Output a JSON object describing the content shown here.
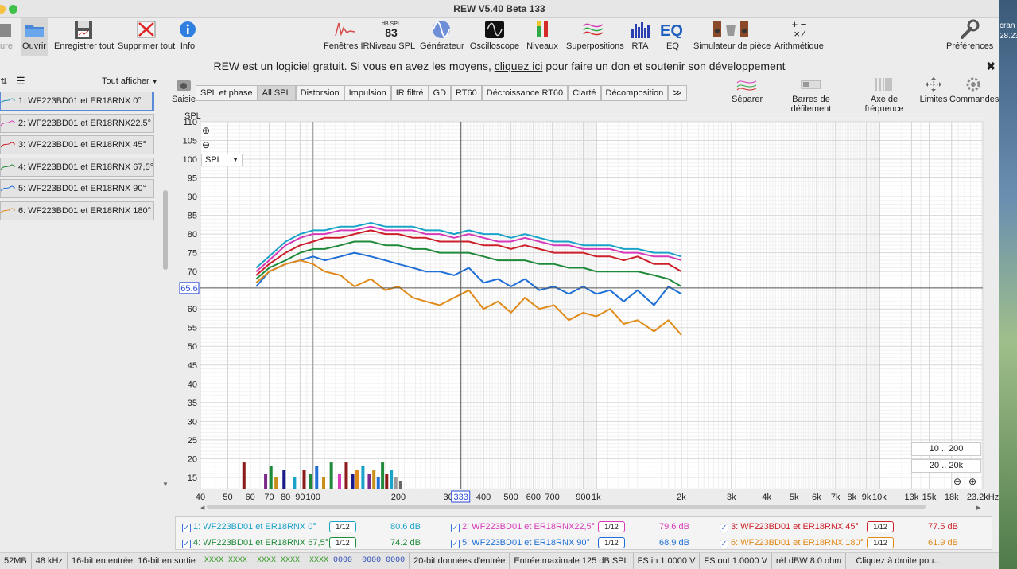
{
  "window": {
    "title": "REW V5.40 Beta 133"
  },
  "toolbar": {
    "left": [
      {
        "label": "ure"
      },
      {
        "label": "Ouvrir"
      },
      {
        "label": "Enregistrer tout"
      },
      {
        "label": "Supprimer tout"
      },
      {
        "label": "Info"
      }
    ],
    "center": [
      {
        "label": "Fenêtres IR"
      },
      {
        "label": "Niveau SPL",
        "badge_top": "dB SPL",
        "badge_val": "83"
      },
      {
        "label": "Générateur"
      },
      {
        "label": "Oscilloscope"
      },
      {
        "label": "Niveaux"
      },
      {
        "label": "Superpositions"
      },
      {
        "label": "RTA"
      },
      {
        "label": "EQ"
      },
      {
        "label": "Simulateur de pièce"
      },
      {
        "label": "Arithmétique"
      }
    ],
    "right": {
      "label": "Préférences"
    }
  },
  "banner": {
    "before": "REW est un logiciel gratuit. Si vous en avez les moyens, ",
    "link": "cliquez ici",
    "after": " pour faire un don et soutenir son développement"
  },
  "left_panel": {
    "show_all": "Tout afficher",
    "capture": "Saisie",
    "items": [
      {
        "label": "1: WF223BD01 et ER18RNX 0°",
        "color": "#1a8fb8"
      },
      {
        "label": "2: WF223BD01 et ER18RNX22,5°",
        "color": "#d63ab8"
      },
      {
        "label": "3: WF223BD01 et ER18RNX 45°",
        "color": "#cc1f2a"
      },
      {
        "label": "4: WF223BD01 et ER18RNX 67,5°",
        "color": "#1f8a3a"
      },
      {
        "label": "5: WF223BD01 et ER18RNX 90°",
        "color": "#1f6fd6"
      },
      {
        "label": "6: WF223BD01 et ER18RNX 180°",
        "color": "#e08a1a"
      }
    ]
  },
  "tabs": [
    "SPL et phase",
    "All SPL",
    "Distorsion",
    "Impulsion",
    "IR filtré",
    "GD",
    "RT60",
    "Décroissance RT60",
    "Clarté",
    "Décomposition",
    "≫"
  ],
  "right_tools": [
    "Séparer",
    "Barres de défilement",
    "Axe de fréquence",
    "Limites",
    "Commandes"
  ],
  "plot": {
    "y_axis_label": "SPL",
    "dropdown": "SPL",
    "cursor_value": "65.6",
    "cursor_freq": "333",
    "range_buttons": [
      "10 .. 200",
      "20 .. 20k"
    ]
  },
  "chart_data": {
    "type": "line",
    "ylabel": "SPL",
    "xlabel": "",
    "xscale": "log",
    "xlim": [
      40,
      23200
    ],
    "ylim": [
      10,
      110
    ],
    "y_ticks": [
      15,
      20,
      25,
      30,
      35,
      40,
      45,
      50,
      55,
      60,
      65,
      70,
      75,
      80,
      85,
      90,
      95,
      100,
      105,
      110
    ],
    "x_tick_labels": [
      {
        "f": 40,
        "t": "40"
      },
      {
        "f": 50,
        "t": "50"
      },
      {
        "f": 60,
        "t": "60"
      },
      {
        "f": 70,
        "t": "70"
      },
      {
        "f": 80,
        "t": "80"
      },
      {
        "f": 90,
        "t": "90"
      },
      {
        "f": 100,
        "t": "100"
      },
      {
        "f": 200,
        "t": "200"
      },
      {
        "f": 300,
        "t": "30"
      },
      {
        "f": 400,
        "t": "400"
      },
      {
        "f": 500,
        "t": "500"
      },
      {
        "f": 600,
        "t": "600"
      },
      {
        "f": 700,
        "t": "700"
      },
      {
        "f": 900,
        "t": "900"
      },
      {
        "f": 1000,
        "t": "1k"
      },
      {
        "f": 2000,
        "t": "2k"
      },
      {
        "f": 3000,
        "t": "3k"
      },
      {
        "f": 4000,
        "t": "4k"
      },
      {
        "f": 5000,
        "t": "5k"
      },
      {
        "f": 6000,
        "t": "6k"
      },
      {
        "f": 7000,
        "t": "7k"
      },
      {
        "f": 8000,
        "t": "8k"
      },
      {
        "f": 9000,
        "t": "9k"
      },
      {
        "f": 10000,
        "t": "10k"
      },
      {
        "f": 13000,
        "t": "13k"
      },
      {
        "f": 15000,
        "t": "15k"
      },
      {
        "f": 18000,
        "t": "18k"
      },
      {
        "f": 23200,
        "t": "23.2kHz"
      }
    ],
    "x": [
      63,
      70,
      80,
      90,
      100,
      110,
      125,
      140,
      160,
      180,
      200,
      225,
      250,
      280,
      315,
      355,
      400,
      450,
      500,
      560,
      630,
      710,
      800,
      900,
      1000,
      1120,
      1250,
      1400,
      1600,
      1800,
      2000
    ],
    "series": [
      {
        "name": "1: WF223BD01 et ER18RNX 0°",
        "color": "#1aa3c8",
        "values": [
          71,
          74,
          78,
          80,
          81,
          81,
          82,
          82,
          83,
          82,
          82,
          82,
          81,
          81,
          80,
          81,
          80,
          80,
          79,
          80,
          79,
          78,
          78,
          77,
          77,
          77,
          76,
          76,
          75,
          75,
          74
        ]
      },
      {
        "name": "2: WF223BD01 et ER18RNX22,5°",
        "color": "#d63ab8",
        "values": [
          70,
          73,
          77,
          79,
          80,
          80,
          81,
          81,
          82,
          81,
          81,
          81,
          80,
          80,
          79,
          80,
          79,
          78,
          78,
          79,
          78,
          77,
          77,
          76,
          76,
          76,
          75,
          75,
          74,
          74,
          73
        ]
      },
      {
        "name": "3: WF223BD01 et ER18RNX 45°",
        "color": "#cc1f2a",
        "values": [
          69,
          72,
          75,
          77,
          78,
          79,
          79,
          80,
          81,
          80,
          80,
          79,
          79,
          78,
          78,
          78,
          77,
          77,
          76,
          77,
          76,
          75,
          75,
          75,
          74,
          74,
          73,
          74,
          72,
          72,
          70
        ]
      },
      {
        "name": "4: WF223BD01 et ER18RNX 67,5°",
        "color": "#1f8a3a",
        "values": [
          68,
          71,
          73,
          75,
          76,
          76,
          77,
          78,
          78,
          77,
          77,
          76,
          76,
          75,
          75,
          75,
          74,
          73,
          73,
          73,
          72,
          72,
          71,
          71,
          70,
          70,
          70,
          70,
          69,
          68,
          66
        ]
      },
      {
        "name": "5: WF223BD01 et ER18RNX 90°",
        "color": "#1f6fd6",
        "values": [
          66,
          70,
          72,
          73,
          74,
          73,
          74,
          75,
          74,
          73,
          72,
          71,
          70,
          70,
          69,
          71,
          67,
          68,
          66,
          68,
          65,
          66,
          64,
          66,
          64,
          65,
          62,
          65,
          61,
          66,
          64
        ]
      },
      {
        "name": "6: WF223BD01 et ER18RNX 180°",
        "color": "#e08a1a",
        "values": [
          67,
          70,
          72,
          73,
          72,
          70,
          69,
          66,
          68,
          65,
          66,
          63,
          62,
          61,
          63,
          65,
          60,
          62,
          59,
          63,
          60,
          61,
          57,
          59,
          58,
          60,
          56,
          57,
          54,
          57,
          53
        ]
      }
    ],
    "bars": [
      {
        "f": 57,
        "h": 19,
        "c": "#8b1a1a"
      },
      {
        "f": 68,
        "h": 16,
        "c": "#7a2a8a"
      },
      {
        "f": 71,
        "h": 18,
        "c": "#1f8a3a"
      },
      {
        "f": 74,
        "h": 15,
        "c": "#c8901a"
      },
      {
        "f": 79,
        "h": 17,
        "c": "#1a1a8a"
      },
      {
        "f": 86,
        "h": 15,
        "c": "#1aa3c8"
      },
      {
        "f": 93,
        "h": 17,
        "c": "#8b1a1a"
      },
      {
        "f": 98,
        "h": 16,
        "c": "#1f8a3a"
      },
      {
        "f": 103,
        "h": 18,
        "c": "#1f6fd6"
      },
      {
        "f": 109,
        "h": 15,
        "c": "#c8901a"
      },
      {
        "f": 116,
        "h": 19,
        "c": "#1f8a3a"
      },
      {
        "f": 124,
        "h": 16,
        "c": "#d63ab8"
      },
      {
        "f": 131,
        "h": 19,
        "c": "#8b1a1a"
      },
      {
        "f": 138,
        "h": 16,
        "c": "#1a1a8a"
      },
      {
        "f": 143,
        "h": 17,
        "c": "#e08a1a"
      },
      {
        "f": 150,
        "h": 18,
        "c": "#1aa3c8"
      },
      {
        "f": 158,
        "h": 16,
        "c": "#7a2a8a"
      },
      {
        "f": 164,
        "h": 17,
        "c": "#c8901a"
      },
      {
        "f": 170,
        "h": 15,
        "c": "#1f6fd6"
      },
      {
        "f": 176,
        "h": 19,
        "c": "#1f8a3a"
      },
      {
        "f": 182,
        "h": 16,
        "c": "#8b1a1a"
      },
      {
        "f": 189,
        "h": 17,
        "c": "#1aa3c8"
      },
      {
        "f": 196,
        "h": 15,
        "c": "#9a9a9a"
      },
      {
        "f": 204,
        "h": 14,
        "c": "#666666"
      }
    ]
  },
  "legend": [
    {
      "label": "1: WF223BD01 et ER18RNX 0°",
      "color": "#1aa3c8",
      "value": "80.6 dB",
      "smooth": "1/12"
    },
    {
      "label": "2: WF223BD01 et ER18RNX22,5°",
      "color": "#d63ab8",
      "value": "79.6 dB",
      "smooth": "1/12"
    },
    {
      "label": "3: WF223BD01 et ER18RNX 45°",
      "color": "#cc1f2a",
      "value": "77.5 dB",
      "smooth": "1/12"
    },
    {
      "label": "4: WF223BD01 et ER18RNX 67,5°",
      "color": "#1f8a3a",
      "value": "74.2 dB",
      "smooth": "1/12"
    },
    {
      "label": "5: WF223BD01 et ER18RNX 90°",
      "color": "#1f6fd6",
      "value": "68.9 dB",
      "smooth": "1/12"
    },
    {
      "label": "6: WF223BD01 et ER18RNX 180°",
      "color": "#e08a1a",
      "value": "61.9 dB",
      "smooth": "1/12"
    }
  ],
  "status": {
    "mem": "52MB",
    "rate": "48 kHz",
    "bits": "16-bit en entrée, 16-bit en sortie",
    "x1": "XXXX XXXX",
    "x2": "XXXX XXXX",
    "x3": "XXXX",
    "z1": "0000",
    "z2": "0000 0000",
    "data": "20-bit données d'entrée",
    "max": "Entrée maximale 125 dB SPL",
    "fsin": "FS in 1.0000 V",
    "fsout": "FS out 1.0000 V",
    "ref": "réf dBW 8.0 ohm",
    "hint": "Cliquez à droite pou…"
  },
  "desktop": {
    "t1": "cran",
    "t2": "28.23"
  }
}
